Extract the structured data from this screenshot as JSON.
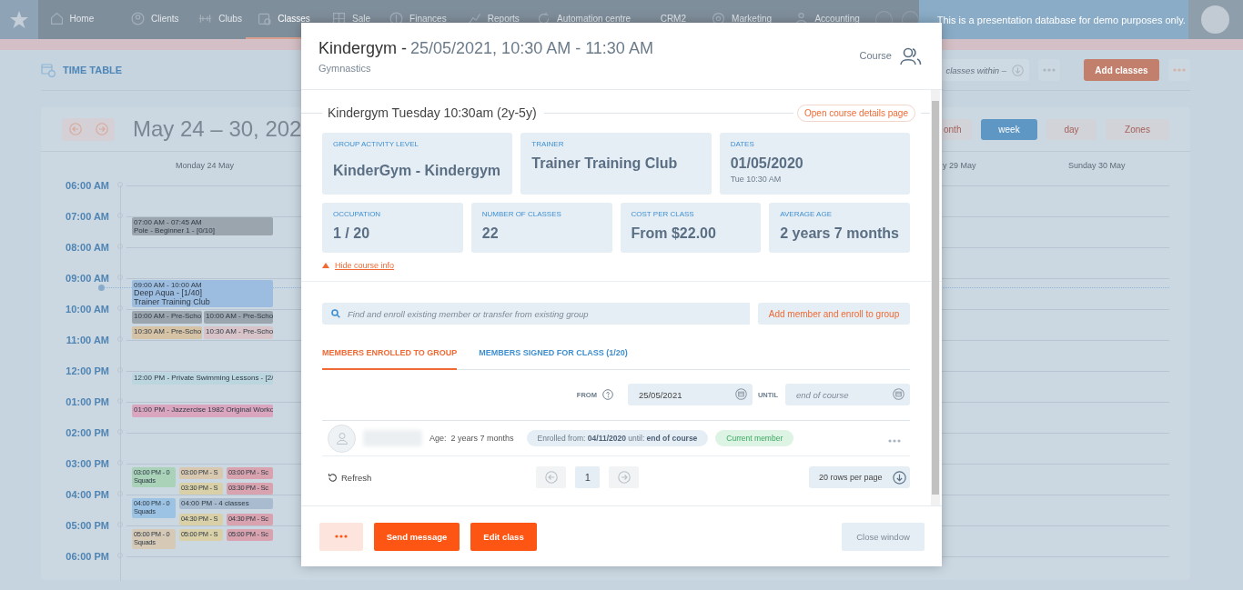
{
  "nav": {
    "items": [
      {
        "label": "Home",
        "selected": false
      },
      {
        "label": "Clients",
        "selected": false
      },
      {
        "label": "Clubs",
        "selected": false
      },
      {
        "label": "Classes",
        "selected": true
      },
      {
        "label": "Sale",
        "selected": false
      },
      {
        "label": "Finances",
        "selected": false
      },
      {
        "label": "Reports",
        "selected": false
      },
      {
        "label": "Automation centre",
        "selected": false
      },
      {
        "label": "CRM2",
        "selected": false
      },
      {
        "label": "Marketing",
        "selected": false
      },
      {
        "label": "Accounting",
        "selected": false
      }
    ],
    "notice": "This is a presentation database for demo purposes only."
  },
  "page": {
    "title": "TIME TABLE",
    "filter_placeholder": "classes within –",
    "add_button": "Add classes"
  },
  "calendar": {
    "range": "May 24 – 30, 202",
    "views": [
      {
        "label": "onth",
        "selected": false
      },
      {
        "label": "week",
        "selected": true
      },
      {
        "label": "day",
        "selected": false
      },
      {
        "label": "Zones",
        "selected": false
      }
    ],
    "days": [
      "Monday 24 May",
      "y 29 May",
      "Sunday 30 May"
    ],
    "hours": [
      "06:00 AM",
      "07:00 AM",
      "08:00 AM",
      "09:00 AM",
      "10:00 AM",
      "11:00 AM",
      "12:00 PM",
      "01:00 PM",
      "02:00 PM",
      "03:00 PM",
      "04:00 PM",
      "05:00 PM",
      "06:00 PM"
    ],
    "events": [
      {
        "time": "07:00 AM - 07:45 AM",
        "title": "Pole - Beginner 1 - [0/10]",
        "color": "#9aa5ae"
      },
      {
        "time": "09:00 AM - 10:00 AM",
        "title": "Deep Aqua - [1/40]",
        "note": "Trainer Training Club",
        "color": "#9dbde0"
      },
      {
        "time": "10:00 AM - Pre-Scho",
        "color": "#9aa5ae"
      },
      {
        "time": "10:00 AM - Pre-Scho",
        "color": "#9aa5ae"
      },
      {
        "time": "10:30 AM - Pre-Scho",
        "color": "#d6c3a5"
      },
      {
        "time": "10:30 AM - Pre-Scho",
        "color": "#d8c4c8"
      },
      {
        "time": "12:00 PM - Private Swimming Lessons - [2/",
        "color": "#bcd6e0"
      },
      {
        "time": "01:00 PM - Jazzercise 1982 Original Worko",
        "color": "#d9a5bf"
      },
      {
        "time": "03:00 PM - 0",
        "title": "Squads",
        "color": "#a9d2b9"
      },
      {
        "time": "03:00 PM - S",
        "color": "#d8c8b0"
      },
      {
        "time": "03:00 PM - Sc",
        "color": "#d8a3ae"
      },
      {
        "time": "03:30 PM - S",
        "color": "#d9d0a8"
      },
      {
        "time": "03:30 PM - Sc",
        "color": "#d8a3ae"
      },
      {
        "time": "04:00 PM - 0",
        "title": "Squads",
        "color": "#9cc3e3"
      },
      {
        "time": "04:00 PM - 4 classes",
        "color": "#a9bccf"
      },
      {
        "time": "04:30 PM - S",
        "color": "#d9d0a8"
      },
      {
        "time": "04:30 PM - Sc",
        "color": "#d8a3ae"
      },
      {
        "time": "05:00 PM - 0",
        "title": "Squads",
        "color": "#d6cab6"
      },
      {
        "time": "05:00 PM - S",
        "color": "#d9d0a8"
      },
      {
        "time": "05:00 PM - Sc",
        "color": "#d8a3ae"
      }
    ]
  },
  "modal": {
    "title": "Kindergym -",
    "time": "25/05/2021, 10:30 AM - 11:30 AM",
    "category": "Gymnastics",
    "type": "Course",
    "section_title": "Kindergym Tuesday 10:30am (2y-5y)",
    "details_link": "Open course details page",
    "info_rows": [
      [
        {
          "label": "GROUP ACTIVITY LEVEL",
          "value": "KinderGym - Kindergym"
        },
        {
          "label": "TRAINER",
          "value": "Trainer Training Club"
        },
        {
          "label": "DATES",
          "value": "01/05/2020",
          "note": "Tue 10:30 AM"
        }
      ],
      [
        {
          "label": "OCCUPATION",
          "value": "1 / 20"
        },
        {
          "label": "NUMBER OF CLASSES",
          "value": "22"
        },
        {
          "label": "COST PER CLASS",
          "value": "From $22.00"
        },
        {
          "label": "AVERAGE AGE",
          "value": "2 years 7 months"
        }
      ]
    ],
    "hide_link": "Hide course info",
    "search_placeholder": "Find and enroll existing member or transfer from existing group",
    "add_member": "Add member and enroll to group",
    "tabs": [
      {
        "label": "MEMBERS ENROLLED TO GROUP",
        "selected": true
      },
      {
        "label": "MEMBERS SIGNED FOR CLASS (1/20)",
        "selected": false
      }
    ],
    "from_label": "FROM",
    "from_value": "25/05/2021",
    "until_label": "UNTIL",
    "until_placeholder": "end of course",
    "members": [
      {
        "age_label": "Age:",
        "age": "2 years 7 months",
        "enrolled": "Enrolled from: **04/11/2020** until: **end of course**",
        "status": "Current member"
      }
    ],
    "refresh": "Refresh",
    "page": "1",
    "rows_per_page": "20 rows per page",
    "buttons": {
      "send": "Send message",
      "edit": "Edit class",
      "close": "Close window"
    }
  }
}
